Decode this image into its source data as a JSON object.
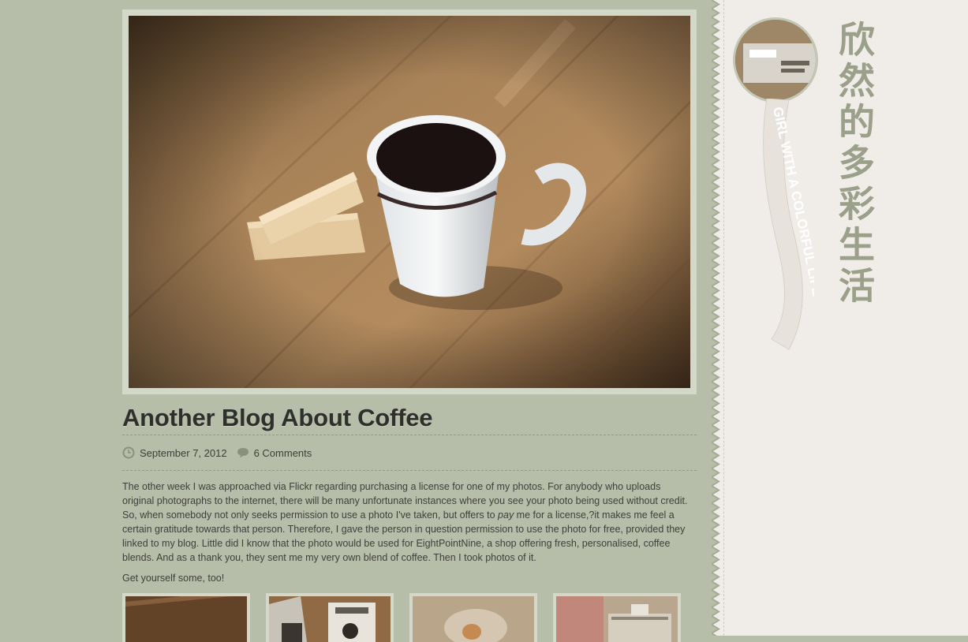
{
  "post": {
    "title": "Another Blog About Coffee",
    "date": "September 7, 2012",
    "comments": "6 Comments",
    "body_before_em": "The other week I was approached via Flickr regarding purchasing a license for one of my photos. For anybody who uploads original photographs to the internet, there will be many unfortunate instances where you see your photo being used without credit. So, when somebody not only seeks permission to use a photo I've taken, but offers to ",
    "body_em": "pay",
    "body_after_em": " me for a license,?it makes me feel a certain gratitude towards that person. Therefore, I gave the person in question permission to use the photo for free, provided they linked to my blog. Little did I know that the photo would be used for EightPointNine, a shop offering fresh, personalised, coffee blends. And as a thank you, they sent me my very own blend of coffee. Then I took photos of it.",
    "cta": "Get yourself some, too!"
  },
  "sidebar": {
    "chinese_title": "欣然的多彩生活",
    "ribbon_text": "GIRL WITH A COLORFUL LIFE"
  },
  "colors": {
    "page_bg": "#b6bda8",
    "frame": "#d4d8c8",
    "sidebar_bg": "#f0ede8",
    "accent_text": "#9aa08a"
  },
  "icons": {
    "date": "clock-icon",
    "comments": "speech-bubble-icon"
  }
}
